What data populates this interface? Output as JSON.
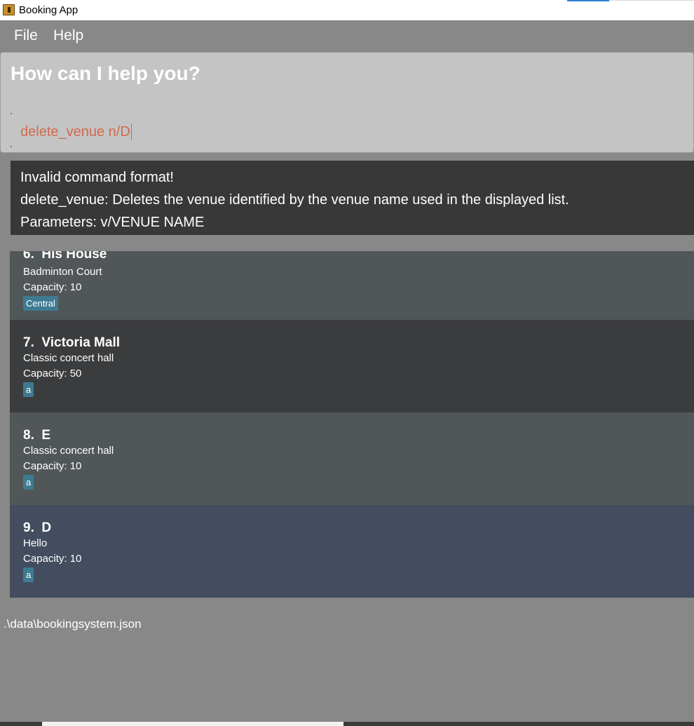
{
  "window": {
    "title": "Booking App",
    "accent_color": "#2f7fd0"
  },
  "menu": {
    "items": [
      "File",
      "Help"
    ]
  },
  "command": {
    "prompt": "How can I help you?",
    "input_value": "delete_venue n/D",
    "input_color": "#d2694e"
  },
  "result": {
    "lines": [
      "Invalid command format!",
      "delete_venue: Deletes the venue identified by the venue name used in the displayed list.",
      "Parameters: v/VENUE NAME"
    ]
  },
  "venues": [
    {
      "index": "6.",
      "name": "His House",
      "description": "Badminton Court",
      "capacity": "Capacity: 10",
      "tags": [
        "Central"
      ],
      "bg": "#515658"
    },
    {
      "index": "7.",
      "name": "Victoria Mall",
      "description": "Classic concert hall",
      "capacity": "Capacity: 50",
      "tags": [
        "a"
      ],
      "bg": "#3b3c3e"
    },
    {
      "index": "8.",
      "name": "E",
      "description": "Classic concert hall",
      "capacity": "Capacity: 10",
      "tags": [
        "a"
      ],
      "bg": "#515658"
    },
    {
      "index": "9.",
      "name": "D",
      "description": "Hello",
      "capacity": "Capacity: 10",
      "tags": [
        "a"
      ],
      "bg": "#434d5f",
      "selected": true
    }
  ],
  "status": {
    "file_path": ".\\data\\bookingsystem.json"
  },
  "colors": {
    "background": "#888888",
    "tag": "#3e7b91",
    "result_bg": "#383838"
  }
}
